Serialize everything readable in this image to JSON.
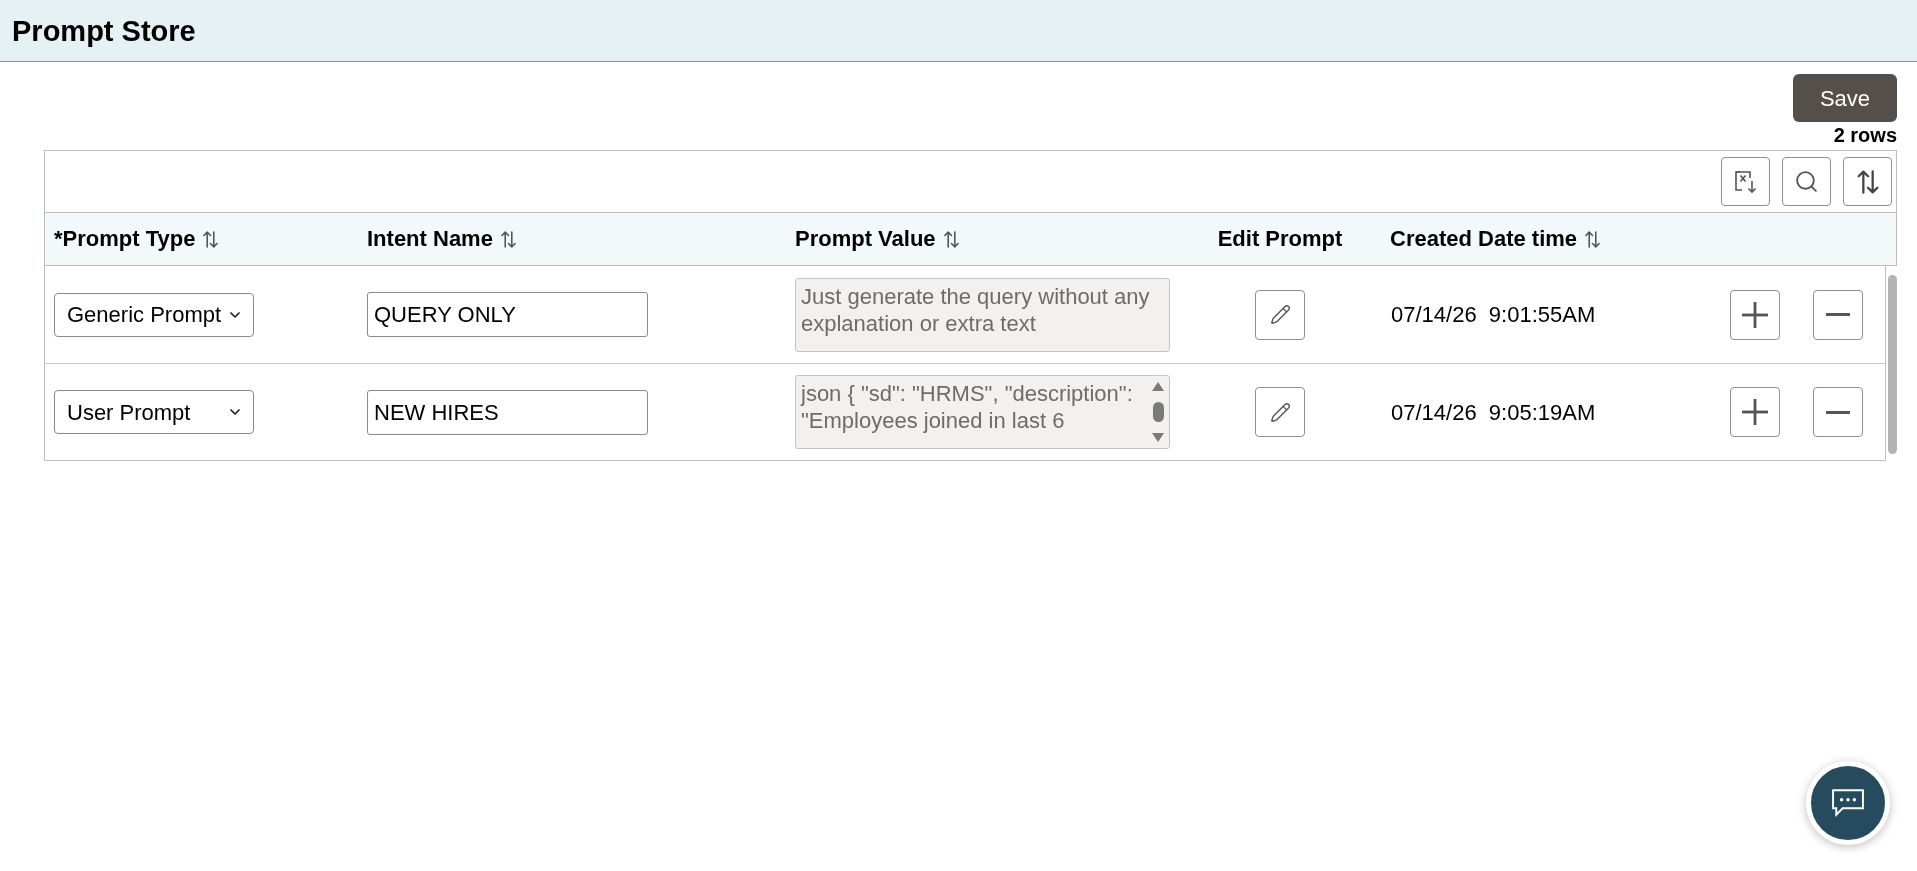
{
  "page": {
    "title": "Prompt Store"
  },
  "actions": {
    "save": "Save",
    "row_count": "2 rows"
  },
  "table": {
    "columns": [
      {
        "label": "*Prompt Type",
        "sortable": true
      },
      {
        "label": "Intent Name",
        "sortable": true
      },
      {
        "label": "Prompt Value",
        "sortable": true
      },
      {
        "label": "Edit Prompt",
        "sortable": false
      },
      {
        "label": "Created Date time",
        "sortable": true
      }
    ],
    "rows": [
      {
        "prompt_type": "Generic Prompt",
        "intent_name": "QUERY ONLY",
        "prompt_value": "Just generate the query without any explanation or extra text",
        "scrollable": false,
        "created": "07/14/26  9:01:55AM"
      },
      {
        "prompt_type": "User Prompt",
        "intent_name": "NEW HIRES",
        "prompt_value": "json { \"sd\": \"HRMS\", \"description\": \"Employees joined in last 6",
        "scrollable": true,
        "created": "07/14/26  9:05:19AM"
      }
    ]
  }
}
